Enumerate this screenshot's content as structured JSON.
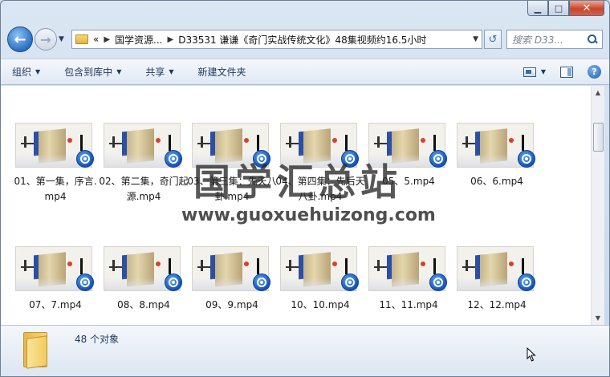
{
  "caption": {
    "minimize": "▁",
    "maximize": "□",
    "close": "✕"
  },
  "address": {
    "overflow": "«",
    "crumbs": [
      "国学资源...",
      "D33531 谦谦《奇门实战传统文化》48集视频约16.5小时"
    ]
  },
  "search": {
    "placeholder": "搜索 D33..."
  },
  "toolbar": {
    "organize": "组织",
    "include_library": "包含到库中",
    "share": "共享",
    "new_folder": "新建文件夹"
  },
  "files": [
    {
      "label": "01、第一集，序言.mp4"
    },
    {
      "label": "02、第二集，奇门起源.mp4"
    },
    {
      "label": "03、第三集：先天八卦.mp4"
    },
    {
      "label": "04、第四集：先后天八卦.mp4"
    },
    {
      "label": "05、5.mp4"
    },
    {
      "label": "06、6.mp4"
    },
    {
      "label": "07、7.mp4"
    },
    {
      "label": "08、8.mp4"
    },
    {
      "label": "09、9.mp4"
    },
    {
      "label": "10、10.mp4"
    },
    {
      "label": "11、11.mp4"
    },
    {
      "label": "12、12.mp4"
    }
  ],
  "watermark": {
    "cn": "国学汇总站",
    "url": "www.guoxuehuizong.com"
  },
  "details": {
    "count": "48 个对象"
  }
}
